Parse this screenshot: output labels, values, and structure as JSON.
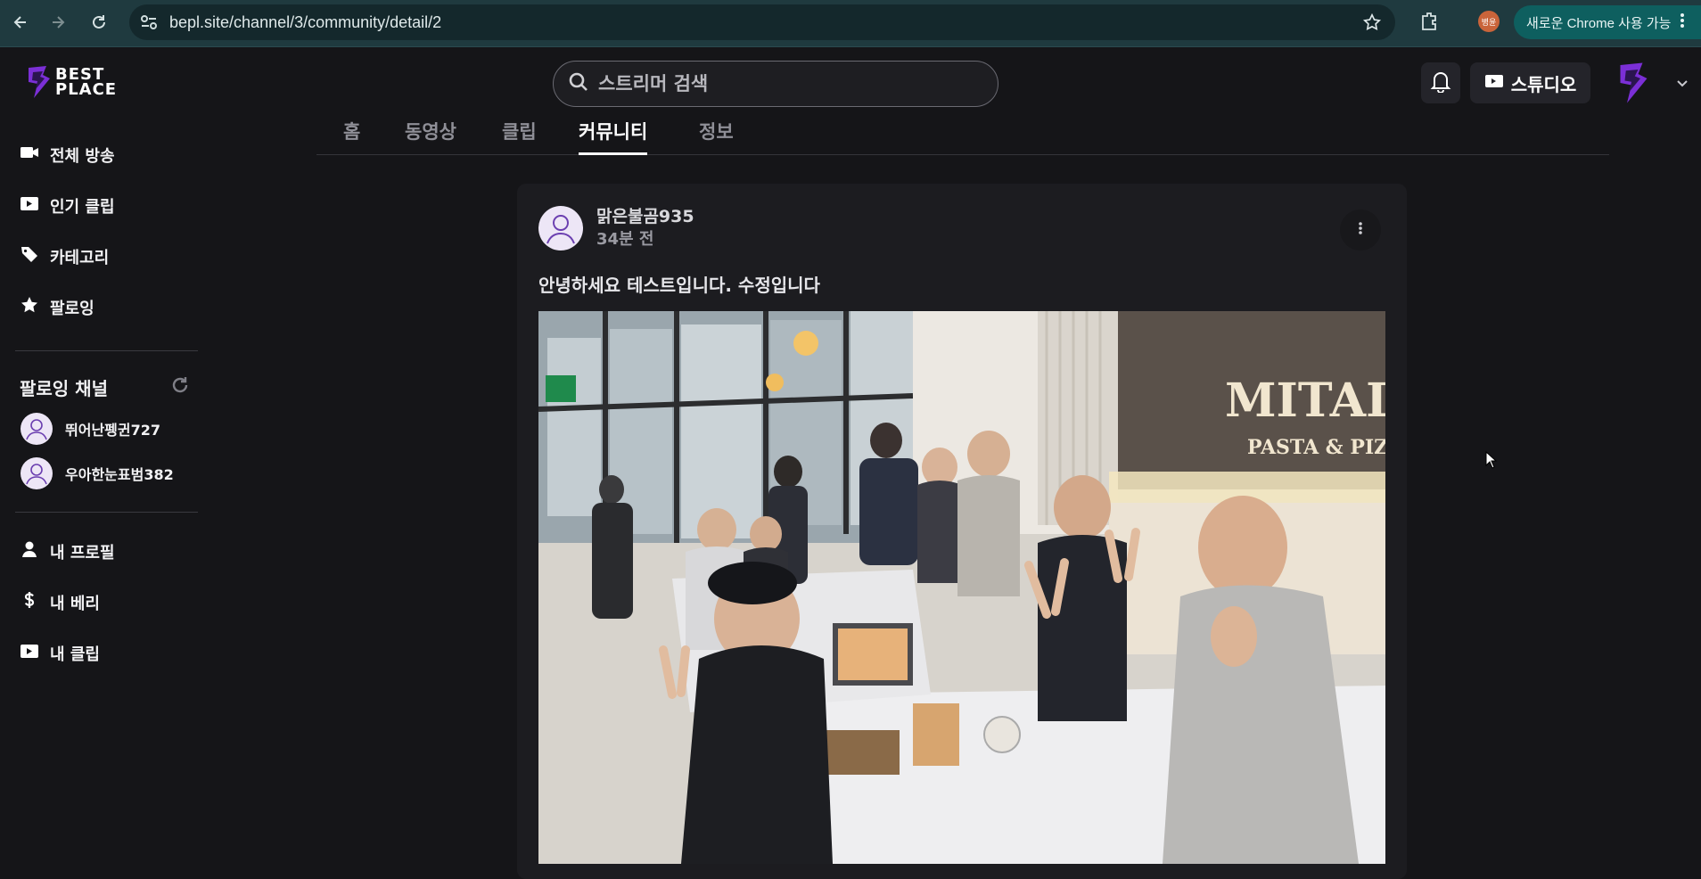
{
  "browser": {
    "url": "bepl.site/channel/3/community/detail/2",
    "profile_initials": "병윤",
    "update_label": "새로운 Chrome 사용 가능"
  },
  "brand": {
    "logo_line1": "BEST",
    "logo_line2": "PLACE",
    "accent": "#7b2fd6"
  },
  "search": {
    "placeholder": "스트리머 검색"
  },
  "header": {
    "studio_label": "스튜디오"
  },
  "sidebar": {
    "main_items": [
      {
        "label": "전체 방송",
        "icon": "video-camera-icon"
      },
      {
        "label": "인기 클립",
        "icon": "clip-icon"
      },
      {
        "label": "카테고리",
        "icon": "tag-icon"
      },
      {
        "label": "팔로잉",
        "icon": "star-icon"
      }
    ],
    "following_title": "팔로잉 채널",
    "following_channels": [
      {
        "name": "뛰어난펭귄727"
      },
      {
        "name": "우아한눈표범382"
      }
    ],
    "my_items": [
      {
        "label": "내 프로필",
        "icon": "person-icon"
      },
      {
        "label": "내 베리",
        "icon": "dollar-icon"
      },
      {
        "label": "내 클립",
        "icon": "clip-icon"
      }
    ]
  },
  "tabs": [
    {
      "label": "홈",
      "active": false
    },
    {
      "label": "동영상",
      "active": false
    },
    {
      "label": "클립",
      "active": false
    },
    {
      "label": "커뮤니티",
      "active": true
    },
    {
      "label": "정보",
      "active": false
    }
  ],
  "post": {
    "author": "맑은불곰935",
    "time": "34분 전",
    "text": "안녕하세요 테스트입니다. 수정입니다",
    "photo_sign_line1": "MITAL",
    "photo_sign_line2": "PASTA & PIZZA"
  }
}
